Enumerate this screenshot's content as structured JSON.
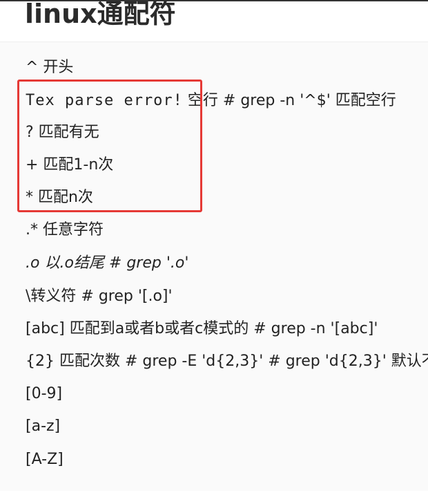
{
  "title": "linux通配符",
  "lines": [
    "^ 开头",
    "Tex parse error!",
    " 空行 # grep -n '^$' 匹配空行",
    "? 匹配有无",
    "+ 匹配1-n次",
    "* 匹配n次",
    ".* 任意字符",
    ".o 以.o结尾 # grep '.o'",
    "\\转义符 # grep '[.o]'",
    "[abc] 匹配到a或者b或者c模式的 # grep -n '[abc]'",
    "{2} 匹配次数 # grep -E 'd{2,3}' # grep 'd{2,3}' 默认不",
    "[0-9]",
    "[a-z]",
    "[A-Z]"
  ],
  "colors": {
    "highlight_border": "#e53935",
    "text": "#222222",
    "background": "#fafafa"
  }
}
